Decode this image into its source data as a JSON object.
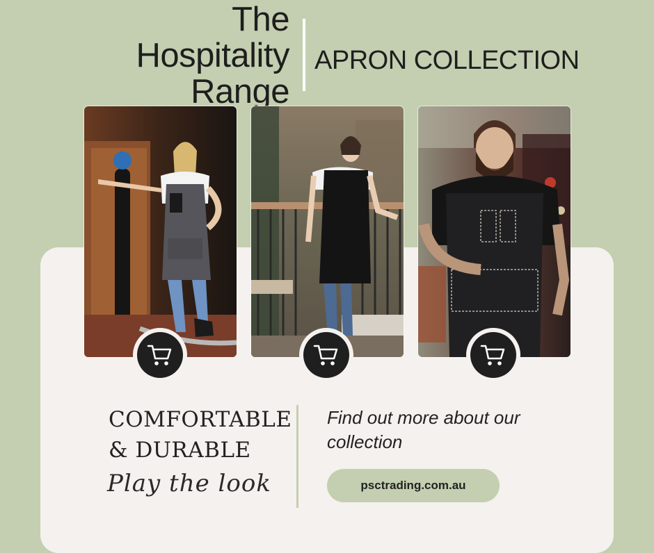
{
  "header": {
    "title_lines": [
      "The",
      "Hospitality",
      "Range"
    ],
    "subtitle": "APRON COLLECTION"
  },
  "products": [
    {
      "photo_icon": "apron-model-photo",
      "cart_icon": "shopping-cart-icon"
    },
    {
      "photo_icon": "apron-model-photo",
      "cart_icon": "shopping-cart-icon"
    },
    {
      "photo_icon": "apron-model-photo",
      "cart_icon": "shopping-cart-icon"
    }
  ],
  "tagline": {
    "line1": "COMFORTABLE",
    "line2": "& DURABLE",
    "script": "Play the look"
  },
  "info": {
    "text": "Find out more about our collection",
    "link_label": "psctrading.com.au"
  },
  "colors": {
    "background": "#c3cfb0",
    "panel": "#f4f1ee",
    "button": "#1f1f1f"
  }
}
